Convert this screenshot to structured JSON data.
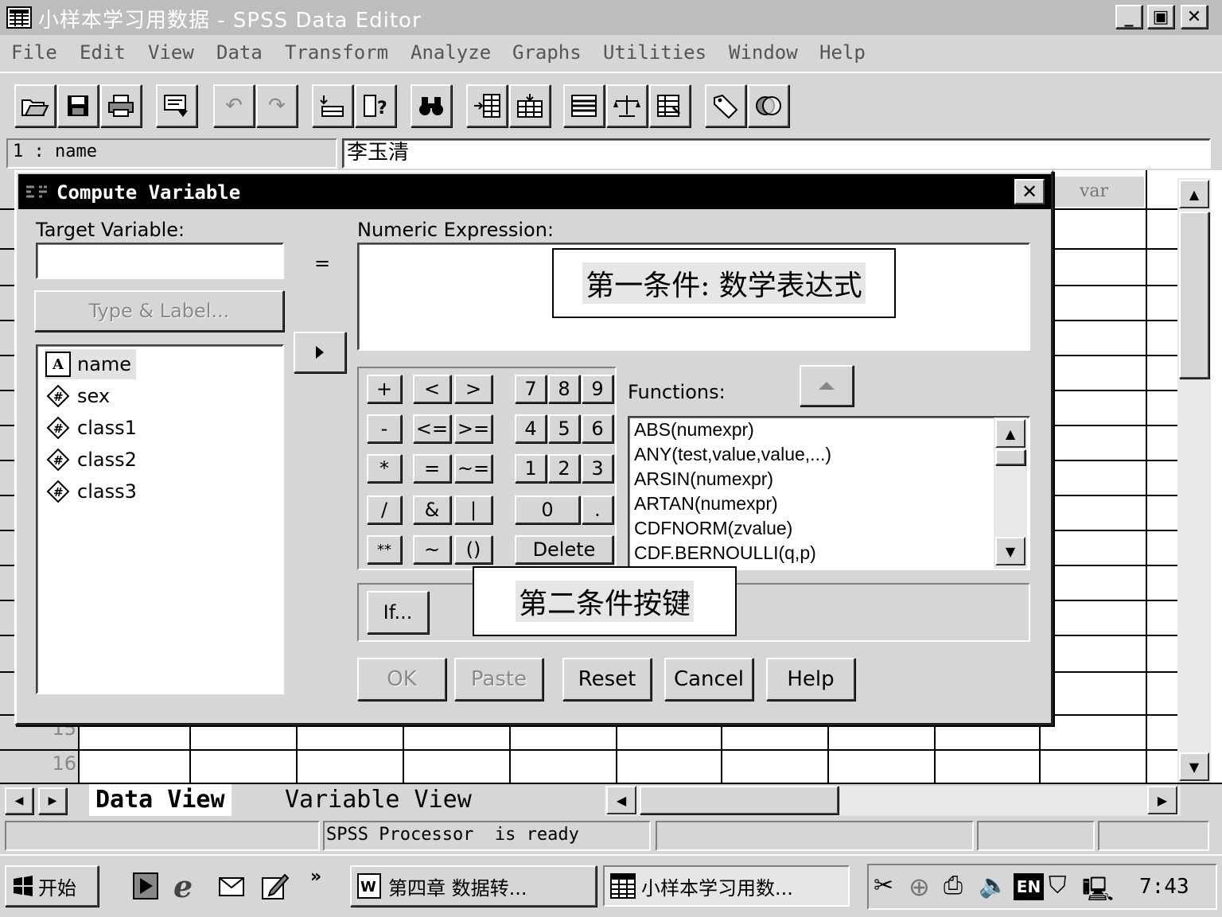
{
  "window": {
    "title": "小样本学习用数据 - SPSS Data Editor",
    "minimize": "_",
    "maximize": "▣",
    "close": "✕"
  },
  "menu": [
    {
      "label": "File"
    },
    {
      "label": "Edit"
    },
    {
      "label": "View"
    },
    {
      "label": "Data"
    },
    {
      "label": "Transform"
    },
    {
      "label": "Analyze"
    },
    {
      "label": "Graphs"
    },
    {
      "label": "Utilities"
    },
    {
      "label": "Window"
    },
    {
      "label": "Help"
    }
  ],
  "cell_editor": {
    "reference": "1 : name",
    "value": "李玉清"
  },
  "grid": {
    "column_header": "var",
    "rows": [
      "15",
      "16"
    ]
  },
  "dialog": {
    "title": "Compute Variable",
    "target_label": "Target Variable:",
    "target_value": "",
    "equals": "=",
    "type_label_button": "Type & Label...",
    "expression_label": "Numeric Expression:",
    "expression_value": "",
    "variables": [
      {
        "name": "name",
        "type": "string",
        "icon": "A"
      },
      {
        "name": "sex",
        "type": "numeric",
        "icon": "#"
      },
      {
        "name": "class1",
        "type": "numeric",
        "icon": "#"
      },
      {
        "name": "class2",
        "type": "numeric",
        "icon": "#"
      },
      {
        "name": "class3",
        "type": "numeric",
        "icon": "#"
      }
    ],
    "keypad": {
      "ops": [
        "+",
        "<",
        ">",
        "-",
        "<=",
        ">=",
        "*",
        "=",
        "~=",
        "/",
        "&",
        "|",
        "**",
        "~",
        "()"
      ],
      "digits": [
        "7",
        "8",
        "9",
        "4",
        "5",
        "6",
        "1",
        "2",
        "3",
        "0",
        "."
      ],
      "delete": "Delete"
    },
    "functions_label": "Functions:",
    "functions": [
      "ABS(numexpr)",
      "ANY(test,value,value,...)",
      "ARSIN(numexpr)",
      "ARTAN(numexpr)",
      "CDFNORM(zvalue)",
      "CDF.BERNOULLI(q,p)"
    ],
    "if_button": "If...",
    "buttons": {
      "ok": "OK",
      "paste": "Paste",
      "reset": "Reset",
      "cancel": "Cancel",
      "help": "Help"
    }
  },
  "callouts": {
    "first": "第一条件: 数学表达式",
    "second": "第二条件按键"
  },
  "tabs": {
    "data_view": "Data View",
    "variable_view": "Variable View"
  },
  "status": {
    "text": "SPSS Processor  is ready"
  },
  "taskbar": {
    "start": "开始",
    "more": "»",
    "task1": "第四章 数据转...",
    "task2": "小样本学习用数...",
    "tray_lang": "EN",
    "clock": "7:43"
  }
}
